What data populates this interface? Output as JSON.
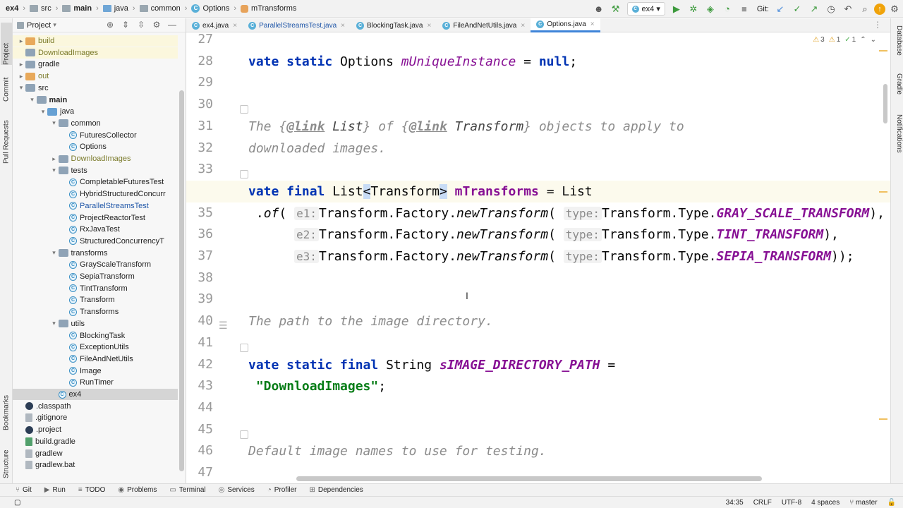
{
  "navbar": {
    "crumbs": [
      "ex4",
      "src",
      "main",
      "java",
      "common",
      "Options",
      "mTransforms"
    ],
    "run_config": "ex4",
    "git_label": "Git:"
  },
  "left_stripe": [
    "Project",
    "Commit",
    "Pull Requests",
    "Bookmarks",
    "Structure"
  ],
  "right_stripe": [
    "Database",
    "Gradle",
    "Notifications"
  ],
  "project": {
    "title": "Project",
    "tree": [
      {
        "label": "build",
        "indent": 1,
        "arrow": "right",
        "icon": "folder-orange",
        "color": "olive",
        "hl": true
      },
      {
        "label": "DownloadImages",
        "indent": 1,
        "arrow": "",
        "icon": "folder",
        "color": "olive",
        "hl": true
      },
      {
        "label": "gradle",
        "indent": 1,
        "arrow": "right",
        "icon": "folder",
        "color": ""
      },
      {
        "label": "out",
        "indent": 1,
        "arrow": "right",
        "icon": "folder-orange",
        "color": "olive"
      },
      {
        "label": "src",
        "indent": 1,
        "arrow": "down",
        "icon": "folder",
        "color": ""
      },
      {
        "label": "main",
        "indent": 2,
        "arrow": "down",
        "icon": "folder",
        "color": "",
        "bold": true
      },
      {
        "label": "java",
        "indent": 3,
        "arrow": "down",
        "icon": "folder-blue",
        "color": ""
      },
      {
        "label": "common",
        "indent": 4,
        "arrow": "down",
        "icon": "folder",
        "color": ""
      },
      {
        "label": "FuturesCollector",
        "indent": 5,
        "arrow": "",
        "icon": "class",
        "color": ""
      },
      {
        "label": "Options",
        "indent": 5,
        "arrow": "",
        "icon": "class",
        "color": ""
      },
      {
        "label": "DownloadImages",
        "indent": 4,
        "arrow": "right",
        "icon": "folder",
        "color": "olive"
      },
      {
        "label": "tests",
        "indent": 4,
        "arrow": "down",
        "icon": "folder",
        "color": ""
      },
      {
        "label": "CompletableFuturesTest",
        "indent": 5,
        "arrow": "",
        "icon": "class",
        "color": ""
      },
      {
        "label": "HybridStructuredConcurr",
        "indent": 5,
        "arrow": "",
        "icon": "class",
        "color": ""
      },
      {
        "label": "ParallelStreamsTest",
        "indent": 5,
        "arrow": "",
        "icon": "class",
        "color": "blue"
      },
      {
        "label": "ProjectReactorTest",
        "indent": 5,
        "arrow": "",
        "icon": "class",
        "color": ""
      },
      {
        "label": "RxJavaTest",
        "indent": 5,
        "arrow": "",
        "icon": "class",
        "color": ""
      },
      {
        "label": "StructuredConcurrencyT",
        "indent": 5,
        "arrow": "",
        "icon": "class",
        "color": ""
      },
      {
        "label": "transforms",
        "indent": 4,
        "arrow": "down",
        "icon": "folder",
        "color": ""
      },
      {
        "label": "GrayScaleTransform",
        "indent": 5,
        "arrow": "",
        "icon": "class",
        "color": ""
      },
      {
        "label": "SepiaTransform",
        "indent": 5,
        "arrow": "",
        "icon": "class",
        "color": ""
      },
      {
        "label": "TintTransform",
        "indent": 5,
        "arrow": "",
        "icon": "class",
        "color": ""
      },
      {
        "label": "Transform",
        "indent": 5,
        "arrow": "",
        "icon": "class",
        "color": ""
      },
      {
        "label": "Transforms",
        "indent": 5,
        "arrow": "",
        "icon": "class",
        "color": ""
      },
      {
        "label": "utils",
        "indent": 4,
        "arrow": "down",
        "icon": "folder",
        "color": ""
      },
      {
        "label": "BlockingTask",
        "indent": 5,
        "arrow": "",
        "icon": "class",
        "color": ""
      },
      {
        "label": "ExceptionUtils",
        "indent": 5,
        "arrow": "",
        "icon": "class",
        "color": ""
      },
      {
        "label": "FileAndNetUtils",
        "indent": 5,
        "arrow": "",
        "icon": "class",
        "color": ""
      },
      {
        "label": "Image",
        "indent": 5,
        "arrow": "",
        "icon": "class",
        "color": ""
      },
      {
        "label": "RunTimer",
        "indent": 5,
        "arrow": "",
        "icon": "class",
        "color": ""
      },
      {
        "label": "ex4",
        "indent": 4,
        "arrow": "",
        "icon": "class",
        "color": "",
        "sel": true
      },
      {
        "label": ".classpath",
        "indent": 1,
        "arrow": "",
        "icon": "eclipse",
        "color": ""
      },
      {
        "label": ".gitignore",
        "indent": 1,
        "arrow": "",
        "icon": "file",
        "color": ""
      },
      {
        "label": ".project",
        "indent": 1,
        "arrow": "",
        "icon": "eclipse",
        "color": ""
      },
      {
        "label": "build.gradle",
        "indent": 1,
        "arrow": "",
        "icon": "gradle",
        "color": ""
      },
      {
        "label": "gradlew",
        "indent": 1,
        "arrow": "",
        "icon": "file",
        "color": ""
      },
      {
        "label": "gradlew.bat",
        "indent": 1,
        "arrow": "",
        "icon": "file",
        "color": ""
      }
    ]
  },
  "tabs": [
    {
      "label": "ex4.java",
      "active": false,
      "blue": false
    },
    {
      "label": "ParallelStreamsTest.java",
      "active": false,
      "blue": true
    },
    {
      "label": "BlockingTask.java",
      "active": false,
      "blue": false
    },
    {
      "label": "FileAndNetUtils.java",
      "active": false,
      "blue": false
    },
    {
      "label": "Options.java",
      "active": true,
      "blue": false
    }
  ],
  "inspections": {
    "warnings": "3",
    "weak": "1",
    "typos": "1"
  },
  "editor": {
    "current_line": 34,
    "line_numbers": [
      "27",
      "28",
      "29",
      "30",
      "31",
      "32",
      "33",
      "34",
      "35",
      "36",
      "37",
      "38",
      "39",
      "40",
      "41",
      "42",
      "43",
      "44",
      "45",
      "46",
      "47"
    ],
    "lines": [
      [],
      [
        {
          "t": "vate static ",
          "c": "kw"
        },
        {
          "t": "Options "
        },
        {
          "t": "mUniqueInstance",
          "c": "fld"
        },
        {
          "t": " = "
        },
        {
          "t": "null",
          "c": "kw"
        },
        {
          "t": ";"
        }
      ],
      [],
      [],
      [
        {
          "t": "The {",
          "c": "cm"
        },
        {
          "t": "@link",
          "c": "cml"
        },
        {
          "t": " List",
          "c": "cmt"
        },
        {
          "t": "} of {",
          "c": "cm"
        },
        {
          "t": "@link",
          "c": "cml"
        },
        {
          "t": " Transform",
          "c": "cmt"
        },
        {
          "t": "} objects to apply to",
          "c": "cm"
        }
      ],
      [
        {
          "t": "downloaded images.",
          "c": "cm"
        }
      ],
      [],
      [
        {
          "t": "vate final ",
          "c": "kw"
        },
        {
          "t": "List"
        },
        {
          "t": "<",
          "c": "brk"
        },
        {
          "t": "Transform"
        },
        {
          "t": ">",
          "c": "brk"
        },
        {
          "t": " "
        },
        {
          "t": "mTransforms",
          "c": "fldb"
        },
        {
          "t": " = List"
        }
      ],
      [
        {
          "t": " ."
        },
        {
          "t": "of",
          "c": "it"
        },
        {
          "t": "( "
        },
        {
          "t": "e1:",
          "c": "hint"
        },
        {
          "t": "Transform.Factory."
        },
        {
          "t": "newTransform",
          "c": "it"
        },
        {
          "t": "( "
        },
        {
          "t": "type:",
          "c": "hint"
        },
        {
          "t": "Transform.Type."
        },
        {
          "t": "GRAY_SCALE_TRANSFORM",
          "c": "cst"
        },
        {
          "t": "),"
        }
      ],
      [
        {
          "t": "      "
        },
        {
          "t": "e2:",
          "c": "hint"
        },
        {
          "t": "Transform.Factory."
        },
        {
          "t": "newTransform",
          "c": "it"
        },
        {
          "t": "( "
        },
        {
          "t": "type:",
          "c": "hint"
        },
        {
          "t": "Transform.Type."
        },
        {
          "t": "TINT_TRANSFORM",
          "c": "cst"
        },
        {
          "t": "),"
        }
      ],
      [
        {
          "t": "      "
        },
        {
          "t": "e3:",
          "c": "hint"
        },
        {
          "t": "Transform.Factory."
        },
        {
          "t": "newTransform",
          "c": "it"
        },
        {
          "t": "( "
        },
        {
          "t": "type:",
          "c": "hint"
        },
        {
          "t": "Transform.Type."
        },
        {
          "t": "SEPIA_TRANSFORM",
          "c": "cst"
        },
        {
          "t": "));"
        }
      ],
      [],
      [],
      [
        {
          "t": "The path to the image directory.",
          "c": "cm"
        }
      ],
      [],
      [
        {
          "t": "vate static final ",
          "c": "kw"
        },
        {
          "t": "String "
        },
        {
          "t": "sIMAGE_DIRECTORY_PATH",
          "c": "cst"
        },
        {
          "t": " ="
        }
      ],
      [
        {
          "t": " "
        },
        {
          "t": "\"DownloadImages\"",
          "c": "str"
        },
        {
          "t": ";"
        }
      ],
      [],
      [],
      [
        {
          "t": "Default image names to use for testing.",
          "c": "cm"
        }
      ],
      []
    ]
  },
  "bottom_tools": [
    "Git",
    "Run",
    "TODO",
    "Problems",
    "Terminal",
    "Services",
    "Profiler",
    "Dependencies"
  ],
  "status": {
    "position": "34:35",
    "line_sep": "CRLF",
    "encoding": "UTF-8",
    "indent": "4 spaces",
    "branch": "master"
  }
}
